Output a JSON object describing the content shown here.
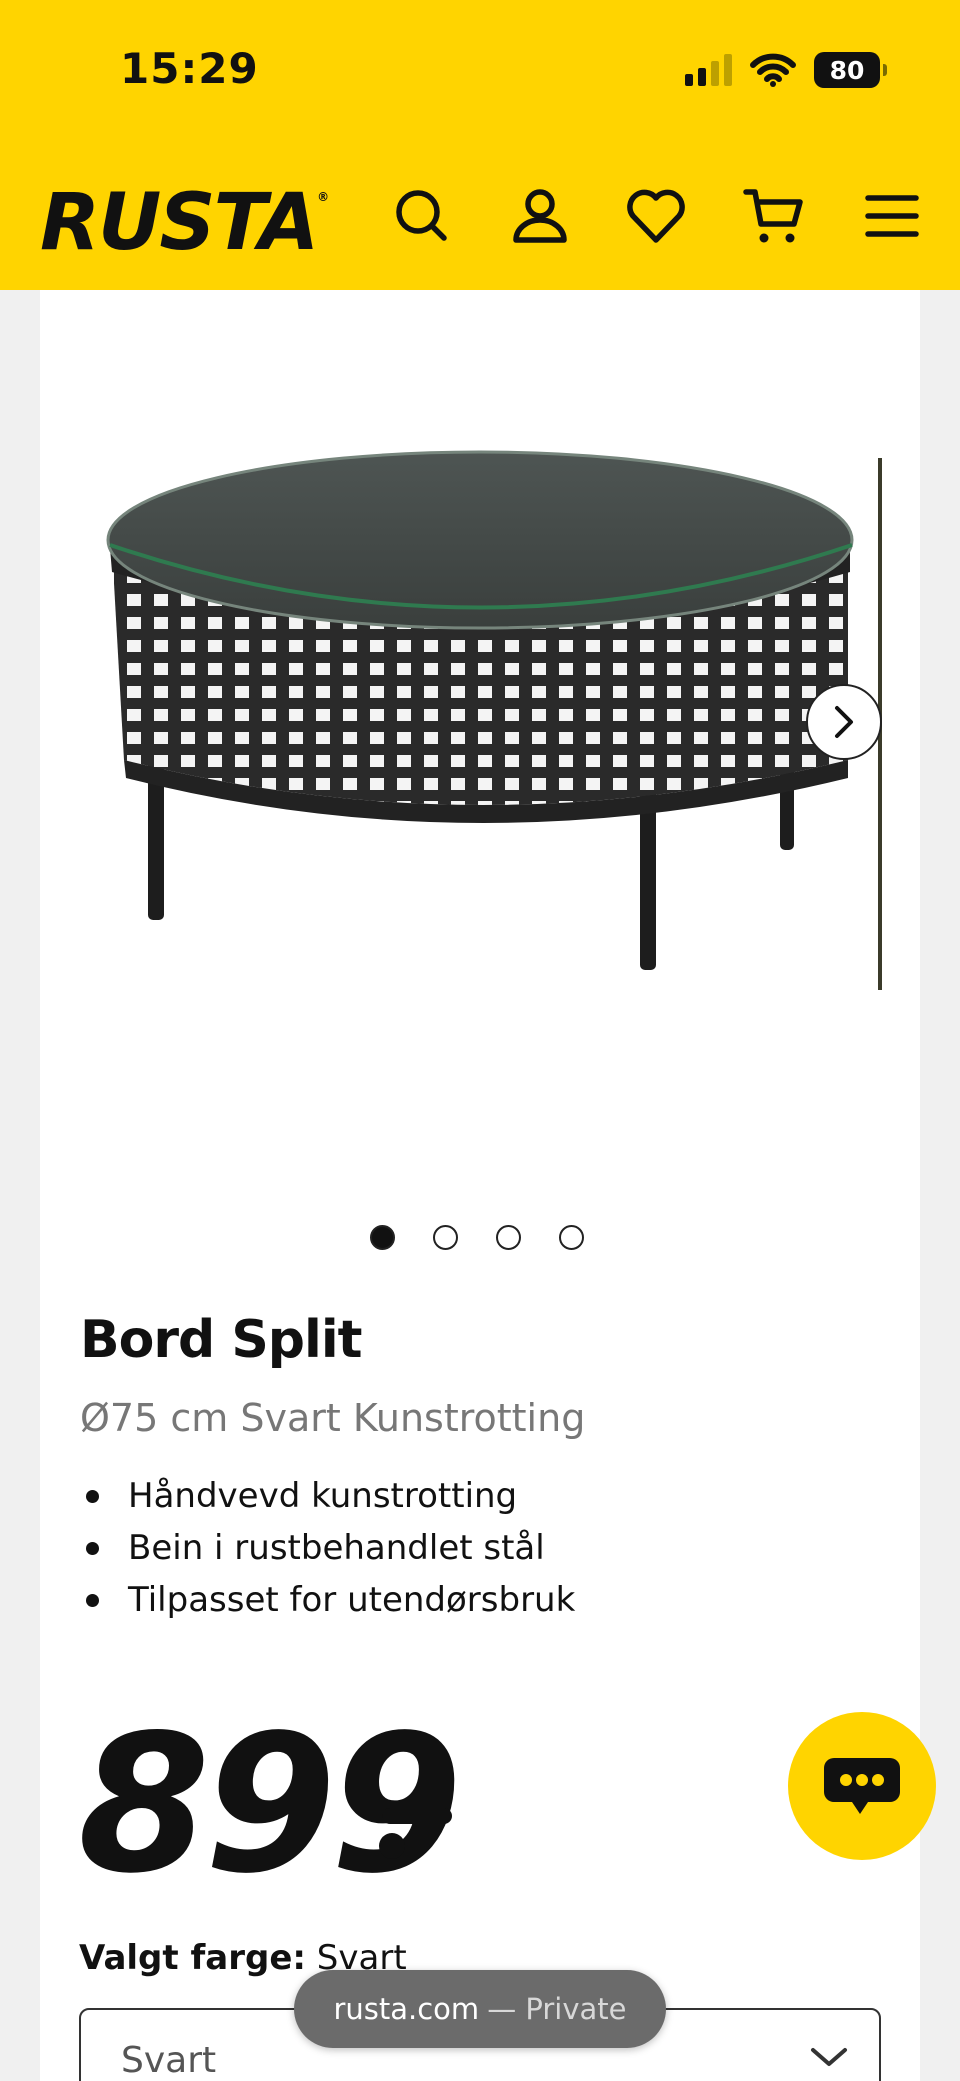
{
  "status_bar": {
    "time": "15:29",
    "battery": "80"
  },
  "header": {
    "logo": "RUSTA",
    "icons": [
      "search-icon",
      "account-icon",
      "heart-icon",
      "cart-icon",
      "menu-icon"
    ]
  },
  "product": {
    "image_count": 4,
    "active_image": 1,
    "title": "Bord Split",
    "subtitle": "Ø75 cm Svart Kunstrotting",
    "features": [
      "Håndvevd kunstrotting",
      "Bein i rustbehandlet stål",
      "Tilpasset for utendørsbruk"
    ],
    "price": "899"
  },
  "color": {
    "label": "Valgt farge:",
    "selected": "Svart",
    "select_value": "Svart"
  },
  "browser": {
    "domain": "rusta.com",
    "mode": "— Private"
  },
  "colors": {
    "brand_yellow": "#ffd400",
    "text": "#111111"
  }
}
